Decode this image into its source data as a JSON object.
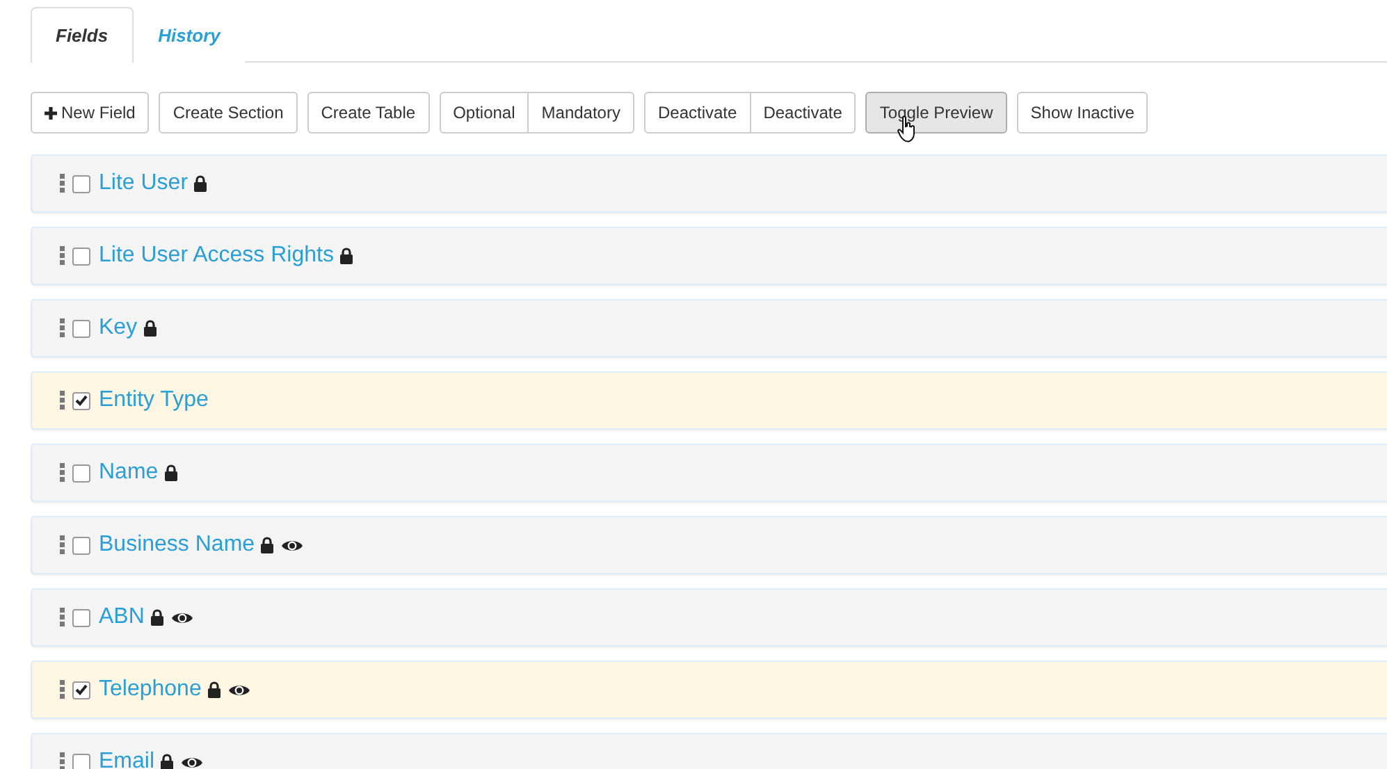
{
  "tabs": [
    {
      "label": "Fields",
      "selected": true
    },
    {
      "label": "History",
      "selected": false
    }
  ],
  "toolbar": [
    {
      "buttons": [
        {
          "label": "New Field",
          "kind": "plus",
          "pressed": false
        }
      ]
    },
    {
      "buttons": [
        {
          "label": "Create Section",
          "pressed": false
        }
      ]
    },
    {
      "buttons": [
        {
          "label": "Create Table",
          "pressed": false
        }
      ]
    },
    {
      "buttons": [
        {
          "label": "Optional",
          "pressed": false
        },
        {
          "label": "Mandatory",
          "pressed": false
        }
      ]
    },
    {
      "buttons": [
        {
          "label": "Deactivate",
          "pressed": false
        },
        {
          "label": "Deactivate",
          "pressed": false
        }
      ]
    },
    {
      "buttons": [
        {
          "label": "Toggle Preview",
          "pressed": true
        }
      ]
    },
    {
      "buttons": [
        {
          "label": "Show Inactive",
          "pressed": false
        }
      ]
    }
  ],
  "fields": [
    {
      "label": "Lite User",
      "checked": false,
      "locked": true,
      "preview": false
    },
    {
      "label": "Lite User Access Rights",
      "checked": false,
      "locked": true,
      "preview": false
    },
    {
      "label": "Key",
      "checked": false,
      "locked": true,
      "preview": false
    },
    {
      "label": "Entity Type",
      "checked": true,
      "locked": false,
      "preview": false
    },
    {
      "label": "Name",
      "checked": false,
      "locked": true,
      "preview": false
    },
    {
      "label": "Business Name",
      "checked": false,
      "locked": true,
      "preview": true
    },
    {
      "label": "ABN",
      "checked": false,
      "locked": true,
      "preview": true
    },
    {
      "label": "Telephone",
      "checked": true,
      "locked": true,
      "preview": true
    },
    {
      "label": "Email",
      "checked": false,
      "locked": true,
      "preview": true
    }
  ]
}
